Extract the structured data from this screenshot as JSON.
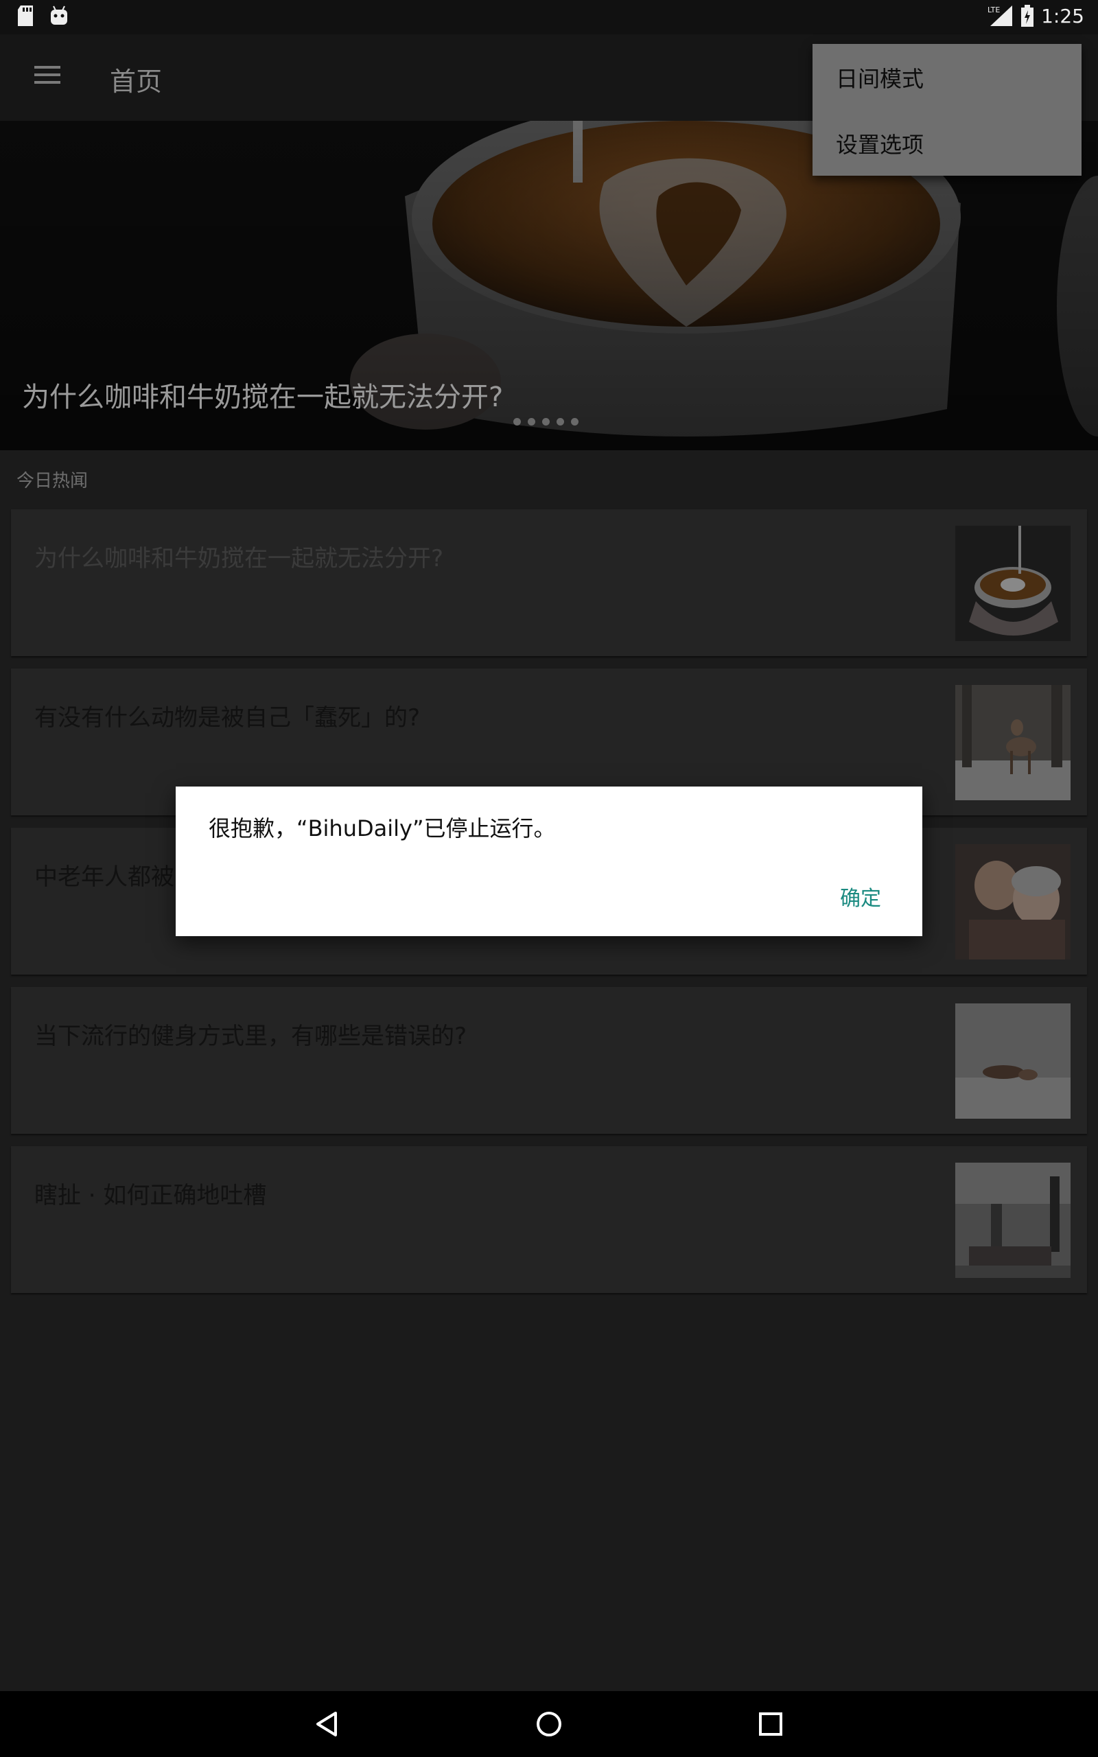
{
  "status_bar": {
    "time": "1:25",
    "network": "LTE",
    "icons": [
      "sd-card-icon",
      "android-icon",
      "lte-signal-icon",
      "battery-icon"
    ]
  },
  "toolbar": {
    "title": "首页",
    "menu_icon": "hamburger-menu-icon"
  },
  "overflow_menu": {
    "items": [
      {
        "label": "日间模式"
      },
      {
        "label": "设置选项"
      }
    ]
  },
  "hero": {
    "title": "为什么咖啡和牛奶搅在一起就无法分开?",
    "page_indicator_count": 5
  },
  "section": {
    "label": "今日热闻"
  },
  "stories": [
    {
      "title": "为什么咖啡和牛奶搅在一起就无法分开?",
      "image": "latte-art-thumbnail"
    },
    {
      "title": "有没有什么动物是被自己「蠢死」的?",
      "image": "deer-in-snow-thumbnail"
    },
    {
      "title": "中老年人都被",
      "image": "elderly-couple-thumbnail"
    },
    {
      "title": "当下流行的健身方式里，有哪些是错误的?",
      "image": "yoga-pose-thumbnail"
    },
    {
      "title": "瞎扯 · 如何正确地吐槽",
      "image": "airport-luggage-thumbnail"
    }
  ],
  "dialog": {
    "message": "很抱歉，“BihuDaily”已停止运行。",
    "ok_label": "确定"
  },
  "colors": {
    "background": "#1b1b1b",
    "card": "#242424",
    "accent": "#1a8a80",
    "dialog": "#ffffff"
  },
  "nav_bar": {
    "buttons": [
      "back-icon",
      "home-icon",
      "recents-icon"
    ]
  }
}
